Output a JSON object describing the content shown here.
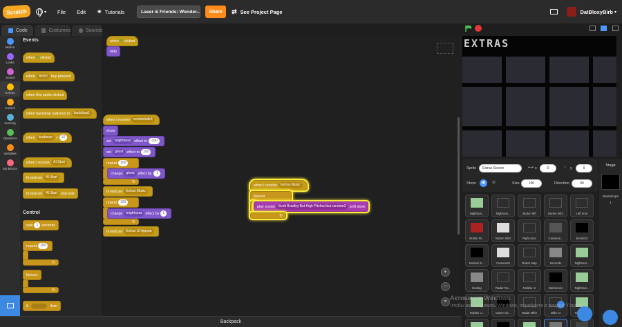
{
  "menu": {
    "logo": "Scratch",
    "file": "File",
    "edit": "Edit",
    "tutorials": "Tutorials",
    "project_title": "Laser & Friends: Wonder...",
    "share": "Share",
    "see_project_page": "See Project Page",
    "username": "DatBloxyBirb"
  },
  "tabs": {
    "code": "Code",
    "costumes": "Costumes",
    "sounds": "Sounds"
  },
  "categories": [
    {
      "label": "Motion",
      "color": "#4c97ff"
    },
    {
      "label": "Looks",
      "color": "#9966ff"
    },
    {
      "label": "Sound",
      "color": "#cf63cf"
    },
    {
      "label": "Events",
      "color": "#ffbf00"
    },
    {
      "label": "Control",
      "color": "#ffab19"
    },
    {
      "label": "Sensing",
      "color": "#5cb1d6"
    },
    {
      "label": "Operators",
      "color": "#59c059"
    },
    {
      "label": "Variables",
      "color": "#ff8c1a"
    },
    {
      "label": "My Blocks",
      "color": "#ff6680"
    }
  ],
  "palette": {
    "events_header": "Events",
    "control_header": "Control",
    "when_flag_clicked_1": "when",
    "when_flag_clicked_2": "clicked",
    "when_key": "when",
    "key_value": "space",
    "key_pressed": "key pressed",
    "when_sprite_clicked": "when this sprite clicked",
    "when_backdrop_switches": "when backdrop switches to",
    "backdrop_value": "backdrop1",
    "when_loudness_1": "when",
    "loudness_value": "loudness",
    "gt": ">",
    "loudness_num": "10",
    "when_receive": "when I receive",
    "receive_value": "AI Start",
    "broadcast": "broadcast",
    "broadcast_value": "AI Start",
    "broadcast_wait": "broadcast",
    "broadcast_wait_value": "AI Start",
    "and_wait": "and wait",
    "wait": "wait",
    "wait_num": "1",
    "seconds": "seconds",
    "repeat": "repeat",
    "repeat_num": "100",
    "forever": "forever",
    "if": "if",
    "then": "then"
  },
  "scripts": {
    "s1_hat_1": "when",
    "s1_hat_2": "clicked",
    "s1_hide": "hide",
    "s2_hat": "when I receive",
    "s2_hat_value": "screenfade2",
    "show": "show",
    "set1": "set",
    "set1_effect": "brightness",
    "set1_to": "effect to",
    "set1_value": "-100",
    "set2": "set",
    "set2_effect": "ghost",
    "set2_to": "effect to",
    "set2_value": "100",
    "repeat1": "repeat",
    "repeat1_value": "100",
    "change1": "change",
    "change1_effect": "ghost",
    "change1_by": "effect by",
    "change1_value": "-1",
    "broadcast1": "broadcast",
    "broadcast1_value": "Extras Music",
    "repeat2": "repeat",
    "repeat2_value": "100",
    "change2": "change",
    "change2_effect": "brightness",
    "change2_by": "effect by",
    "change2_value": "1",
    "broadcast2": "broadcast",
    "broadcast2_value": "Extras UI Appear",
    "s3_hat": "when I receive",
    "s3_hat_value": "Extras Music",
    "forever": "forever",
    "play_sound": "play sound",
    "sound_value": "Scott Bradley But High Pitched but random3",
    "until_done": "until done"
  },
  "stage": {
    "title": "EXTRAS"
  },
  "sprite_info": {
    "sprite_label": "Sprite",
    "sprite_name": "Extras Screen",
    "x_label": "x",
    "x_value": "0",
    "y_label": "y",
    "y_value": "0",
    "show_label": "Show",
    "size_label": "Size",
    "size_value": "100",
    "direction_label": "Direction",
    "direction_value": "90"
  },
  "sprites": [
    "Nightmar...",
    "Nightmar...",
    "Button left",
    "Button left2",
    "Left door",
    "Button Ri...",
    "Button left3",
    "Right door",
    "Cameras...",
    "Monitor2",
    "Monitor S...",
    "Cameras3",
    "Radar Map",
    "Seconds",
    "Nightmar...",
    "Ending",
    "Radar Ro...",
    "Robbie AI",
    "Darkness1",
    "Nightmar...",
    "Robbie J...",
    "Game Ov...",
    "Radar Mike",
    "Mike AI",
    "Nightmar...",
    "Mike Jum...",
    "",
    "Mini Twe...",
    "Extras Sc...",
    ""
  ],
  "stage_panel": {
    "label": "Stage",
    "backdrops_label": "Backdrops",
    "backdrops_count": "1"
  },
  "backpack": "Backpack",
  "watermark": "Активация Windows",
  "watermark_sub": "Чтобы активировать Windows, перейдите в раздел \"Парам..."
}
